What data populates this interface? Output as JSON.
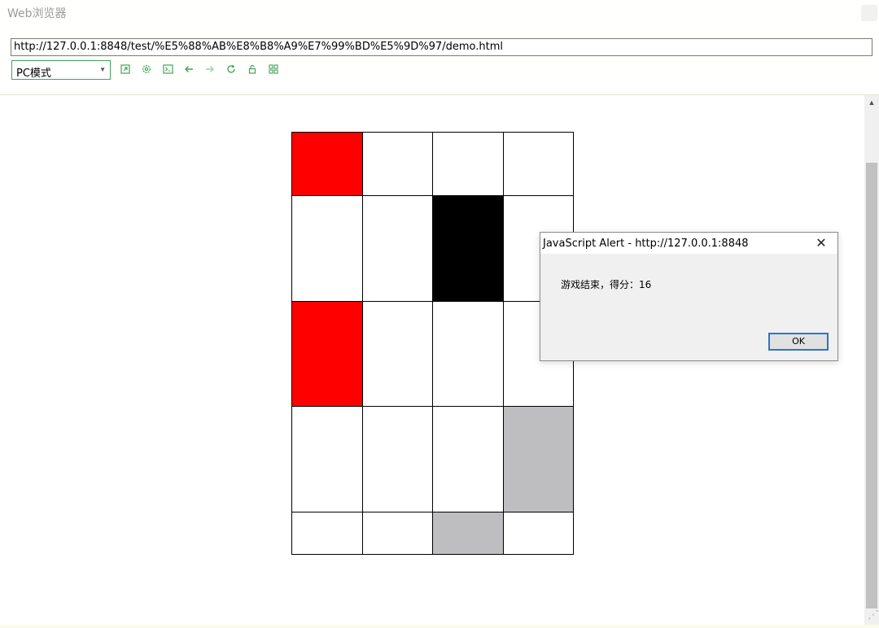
{
  "window": {
    "title": "Web浏览器"
  },
  "toolbar": {
    "url": "http://127.0.0.1:8848/test/%E5%88%AB%E8%B8%A9%E7%99%BD%E5%9D%97/demo.html",
    "mode": "PC模式",
    "icons": [
      "open-external-icon",
      "settings-icon",
      "console-icon",
      "back-arrow-icon",
      "forward-arrow-icon",
      "reload-icon",
      "lock-icon",
      "grid-icon"
    ],
    "accent_color": "#3fa35a"
  },
  "game": {
    "columns": 4,
    "rows": [
      {
        "height_ratio": 78,
        "cells": [
          "red",
          "white",
          "white",
          "white"
        ]
      },
      {
        "height_ratio": 130,
        "cells": [
          "white",
          "white",
          "black",
          "white"
        ]
      },
      {
        "height_ratio": 130,
        "cells": [
          "red",
          "white",
          "white",
          "white"
        ]
      },
      {
        "height_ratio": 130,
        "cells": [
          "white",
          "white",
          "white",
          "gray"
        ]
      },
      {
        "height_ratio": 52,
        "cells": [
          "white",
          "white",
          "gray",
          "white"
        ]
      }
    ],
    "colors": {
      "red": "#ff0000",
      "black": "#000000",
      "gray": "#bebdbf",
      "white": "#ffffff"
    }
  },
  "alert": {
    "title": "JavaScript Alert - http://127.0.0.1:8848",
    "message": "游戏结束，得分：16",
    "ok_label": "OK",
    "close_glyph": "✕"
  }
}
